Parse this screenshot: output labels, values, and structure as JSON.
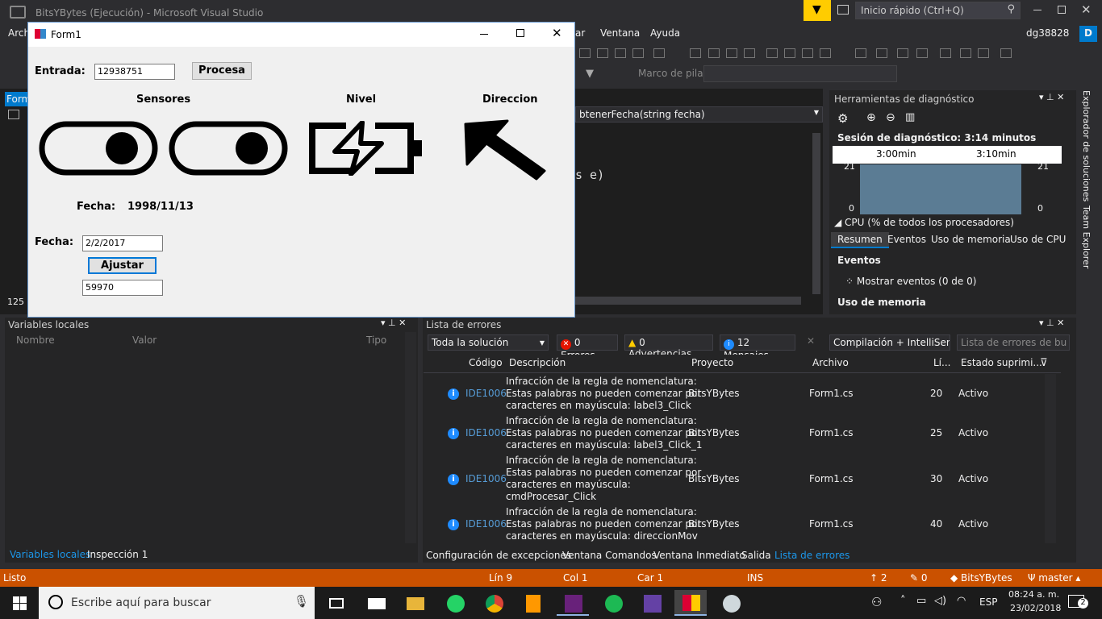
{
  "vs": {
    "title": "BitsYBytes (Ejecución) - Microsoft Visual Studio",
    "quick_launch": "Inicio rápido (Ctrl+Q)",
    "user": "dg38828",
    "avatar": "D",
    "menu": [
      "Arch",
      "ar",
      "Ventana",
      "Ayuda"
    ],
    "stack_label": "Marco de pila:",
    "zoom": "125 %"
  },
  "editor": {
    "tab_label": "Form",
    "method_dropdown": "btenerFecha(string fecha)",
    "code_line": "s e)"
  },
  "form": {
    "title": "Form1",
    "entrada_label": "Entrada:",
    "entrada_value": "12938751",
    "procesa_btn": "Procesa",
    "sensores_label": "Sensores",
    "nivel_label": "Nivel",
    "direccion_label": "Direccion",
    "fecha_label": "Fecha:",
    "fecha_value": "1998/11/13",
    "fecha_input_label": "Fecha:",
    "fecha_input_value": "2/2/2017",
    "ajustar_btn": "Ajustar",
    "result_value": "59970"
  },
  "diag": {
    "title": "Herramientas de diagnóstico",
    "session": "Sesión de diagnóstico: 3:14 minutos",
    "t1": "3:00min",
    "t2": "3:10min",
    "y_top_left": "21",
    "y_top_right": "21",
    "y_bot_left": "0",
    "y_bot_right": "0",
    "cpu_label": "CPU (% de todos los procesadores)",
    "tabs": [
      "Resumen",
      "Eventos",
      "Uso de memoria",
      "Uso de CPU"
    ],
    "events_hdr": "Eventos",
    "events_show": "Mostrar eventos (0 de 0)",
    "mem_hdr": "Uso de memoria"
  },
  "side_tabs": [
    "Explorador de soluciones",
    "Team Explorer"
  ],
  "locals": {
    "title": "Variables locales",
    "cols": [
      "Nombre",
      "Valor",
      "Tipo"
    ],
    "bottom_tabs": [
      "Variables locales",
      "Inspección 1"
    ]
  },
  "errors": {
    "title": "Lista de errores",
    "scope": "Toda la solución",
    "err_count": "0 Errores",
    "warn_count": "0 Advertencias",
    "msg_count": "12 Mensajes",
    "build": "Compilación + IntelliSen",
    "search": "Lista de errores de bu",
    "cols": [
      "Código",
      "Descripción",
      "Proyecto",
      "Archivo",
      "Lí...",
      "Estado suprimi..."
    ],
    "rows": [
      {
        "code": "IDE1006",
        "desc": [
          "Infracción de la regla de nomenclatura:",
          "Estas palabras no pueden comenzar por",
          "caracteres en mayúscula: label3_Click"
        ],
        "project": "BitsYBytes",
        "file": "Form1.cs",
        "line": "20",
        "state": "Activo"
      },
      {
        "code": "IDE1006",
        "desc": [
          "Infracción de la regla de nomenclatura:",
          "Estas palabras no pueden comenzar por",
          "caracteres en mayúscula: label3_Click_1"
        ],
        "project": "BitsYBytes",
        "file": "Form1.cs",
        "line": "25",
        "state": "Activo"
      },
      {
        "code": "IDE1006",
        "desc": [
          "Infracción de la regla de nomenclatura:",
          "Estas palabras no pueden comenzar por",
          "caracteres en mayúscula:",
          "cmdProcesar_Click"
        ],
        "project": "BitsYBytes",
        "file": "Form1.cs",
        "line": "30",
        "state": "Activo"
      },
      {
        "code": "IDE1006",
        "desc": [
          "Infracción de la regla de nomenclatura:",
          "Estas palabras no pueden comenzar por",
          "caracteres en mayúscula: direccionMov"
        ],
        "project": "BitsYBytes",
        "file": "Form1.cs",
        "line": "40",
        "state": "Activo"
      }
    ],
    "bottom_tabs": [
      "Configuración de excepciones",
      "Ventana Comandos",
      "Ventana Inmediato",
      "Salida",
      "Lista de errores"
    ]
  },
  "status": {
    "ready": "Listo",
    "line": "Lín 9",
    "col": "Col 1",
    "car": "Car 1",
    "ins": "INS",
    "up": "2",
    "pencil": "0",
    "repo": "BitsYBytes",
    "branch": "master"
  },
  "taskbar": {
    "search": "Escribe aquí para buscar",
    "lang": "ESP",
    "time": "08:24 a. m.",
    "date": "23/02/2018",
    "notif": "2"
  },
  "colors": {
    "accent": "#007acc",
    "status": "#ca5100",
    "info": "#1e8bff"
  }
}
